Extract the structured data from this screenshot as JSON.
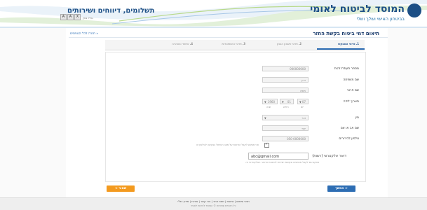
{
  "header": {
    "logo_title": "המוסד לביטוח לאומי",
    "logo_subtitle": "בביטחון האישי ושלך ושלי",
    "tagline": "תשלומים, דיווחים ושירותים",
    "lang_label": "גודל גופן",
    "controls": [
      "A",
      "A",
      "X"
    ]
  },
  "nav": {
    "back_link": "חזרה לכל הטפסים"
  },
  "page": {
    "title": "תיאום דמי ביטוח בקשת החזר"
  },
  "steps": [
    {
      "num": "1.",
      "label": "פרטי המבקש"
    },
    {
      "num": "2.",
      "label": "פרטי חשבון הבנק"
    },
    {
      "num": "3.",
      "label": "פרטי ההשתכרות"
    },
    {
      "num": "4.",
      "label": "אישור והצהרה"
    }
  ],
  "form": {
    "id_label": "מספר תעודת זהות",
    "id_value": "000000000",
    "last_name_label": "שם משפחה",
    "last_name_value": "כהן",
    "first_name_label": "שם פרטי",
    "first_name_value": "משה",
    "dob_label": "תאריך לידה",
    "dob_day": "07",
    "dob_month": "01",
    "dob_year": "1960",
    "dob_day_sub": "יום",
    "dob_month_sub": "חודש",
    "dob_year_sub": "שנה",
    "gender_label": "מין",
    "gender_value": "זכר",
    "fathers_name_label": "שם אב או אם",
    "fathers_name_value": "יוסי",
    "phone_label": "טלפון לבירורים",
    "phone_value": "050-0000000",
    "sms_note": "אני מבקש לקבל הודעות על מצב הטיפול בבקשה לטלפון זה",
    "email_label": "דואר אלקטרוני (רשות)",
    "email_value": "abc@gmail.com",
    "email_note": "מבקש גם לקבל מכתבים ובקשות ישירות לכתובת הדואר האלקטרוני זה"
  },
  "buttons": {
    "next": "המשך >",
    "save": "< שמור"
  },
  "footer": {
    "links": "תנאי שימוש | נגישות | מפת אתר | צור קשר | אודות | מידע כללי",
    "copyright": "כל הזכויות שמורות © המוסד לביטוח לאומי"
  },
  "colors": {
    "brand": "#1c4f86",
    "accent": "#2d6db3",
    "save": "#f39a1f"
  }
}
